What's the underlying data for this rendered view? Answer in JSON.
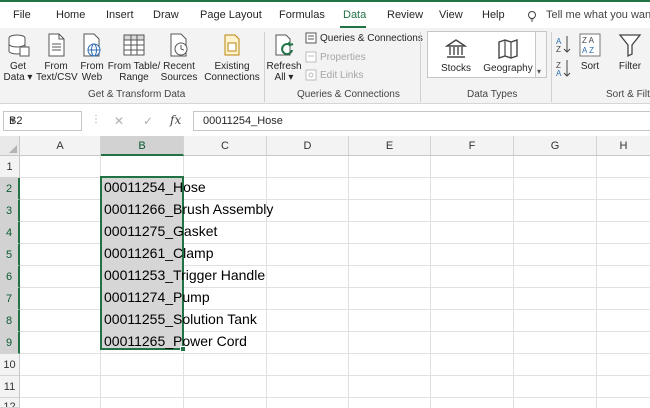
{
  "ribbon_tabs": [
    {
      "label": "File"
    },
    {
      "label": "Home"
    },
    {
      "label": "Insert"
    },
    {
      "label": "Draw"
    },
    {
      "label": "Page Layout"
    },
    {
      "label": "Formulas"
    },
    {
      "label": "Data"
    },
    {
      "label": "Review"
    },
    {
      "label": "View"
    },
    {
      "label": "Help"
    }
  ],
  "active_tab": "Data",
  "tell_me": "Tell me what you want",
  "accent_color": "#217346",
  "ribbon": {
    "get_data": {
      "line1": "Get",
      "line2": "Data ▾",
      "icon": "database-icon"
    },
    "from_text_csv": {
      "line1": "From",
      "line2": "Text/CSV",
      "icon": "text-file-icon"
    },
    "from_web": {
      "line1": "From",
      "line2": "Web",
      "icon": "web-icon"
    },
    "from_table_range": {
      "line1": "From Table/",
      "line2": "Range",
      "icon": "table-icon"
    },
    "recent_sources": {
      "line1": "Recent",
      "line2": "Sources",
      "icon": "clock-file-icon"
    },
    "existing_connections": {
      "line1": "Existing",
      "line2": "Connections",
      "icon": "connections-icon"
    },
    "group_get_transform": "Get & Transform Data",
    "refresh_all": {
      "line1": "Refresh",
      "line2": "All ▾",
      "icon": "refresh-icon"
    },
    "queries_connections": "Queries & Connections",
    "properties": "Properties",
    "edit_links": "Edit Links",
    "group_queries": "Queries & Connections",
    "stocks": {
      "label": "Stocks",
      "icon": "bank-icon"
    },
    "geography": {
      "label": "Geography",
      "icon": "map-icon"
    },
    "group_data_types": "Data Types",
    "sort": {
      "label": "Sort",
      "icon": "sort-icon"
    },
    "filter": {
      "label": "Filter",
      "icon": "filter-icon"
    },
    "group_sort_filter": "Sort & Filt"
  },
  "formula_bar": {
    "name_box": "B2",
    "fx": "fx",
    "content": "00011254_Hose"
  },
  "columns": [
    "A",
    "B",
    "C",
    "D",
    "E",
    "F",
    "G",
    "H"
  ],
  "rows": [
    "1",
    "2",
    "3",
    "4",
    "5",
    "6",
    "7",
    "8",
    "9",
    "10",
    "11",
    "12"
  ],
  "cells_b": [
    "00011254_Hose",
    "00011266_Brush Assembly",
    "00011275_Gasket",
    "00011261_Clamp",
    "00011253_Trigger Handle",
    "00011274_Pump",
    "00011255_Solution Tank",
    "00011265_Power Cord"
  ]
}
